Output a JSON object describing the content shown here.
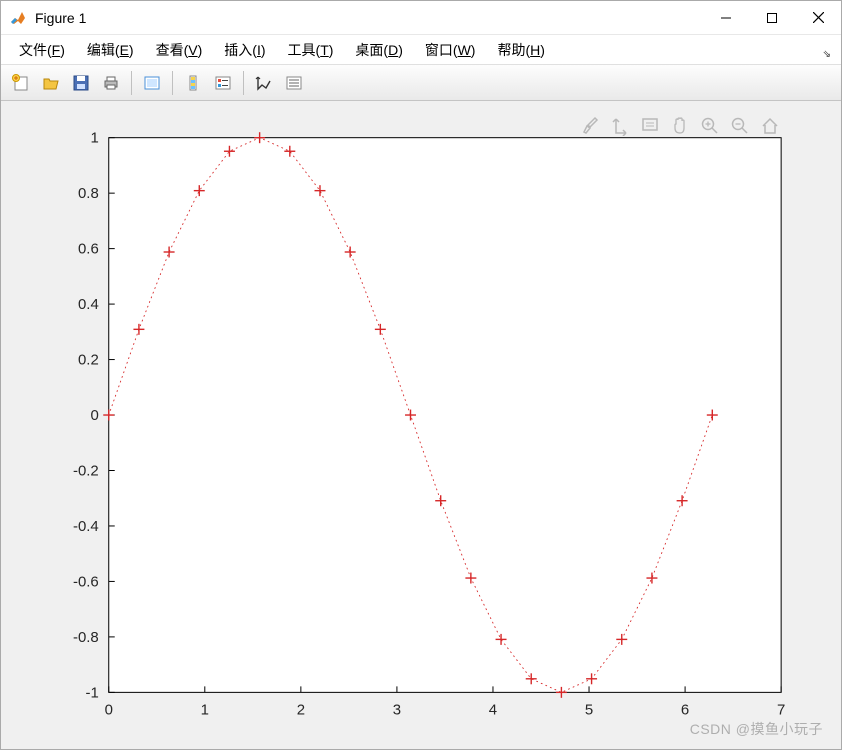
{
  "window": {
    "title": "Figure 1"
  },
  "menu": {
    "items": [
      {
        "label": "文件",
        "mnemonic": "F"
      },
      {
        "label": "编辑",
        "mnemonic": "E"
      },
      {
        "label": "查看",
        "mnemonic": "V"
      },
      {
        "label": "插入",
        "mnemonic": "I"
      },
      {
        "label": "工具",
        "mnemonic": "T"
      },
      {
        "label": "桌面",
        "mnemonic": "D"
      },
      {
        "label": "窗口",
        "mnemonic": "W"
      },
      {
        "label": "帮助",
        "mnemonic": "H"
      }
    ]
  },
  "toolbar_icons": [
    "new-figure",
    "open",
    "save",
    "print",
    "link",
    "linked-axes",
    "insert-colorbar",
    "insert-legend",
    "edit-plot",
    "data-cursor"
  ],
  "axes_toolbar_icons": [
    "brush",
    "rotate",
    "datatips",
    "pan",
    "zoom-in",
    "zoom-out",
    "home"
  ],
  "watermark": "CSDN @摸鱼小玩子",
  "colors": {
    "marker": "#d62728",
    "line": "#d62728",
    "axis": "#000000",
    "tick": "#262626",
    "background": "#f0f0f0"
  },
  "chart_data": {
    "type": "scatter",
    "title": "",
    "xlabel": "",
    "ylabel": "",
    "xlim": [
      0,
      7
    ],
    "ylim": [
      -1,
      1
    ],
    "xticks": [
      0,
      1,
      2,
      3,
      4,
      5,
      6,
      7
    ],
    "yticks": [
      -1,
      -0.8,
      -0.6,
      -0.4,
      -0.2,
      0,
      0.2,
      0.4,
      0.6,
      0.8,
      1
    ],
    "line_style": "dotted",
    "marker": "+",
    "x": [
      0,
      0.3142,
      0.6283,
      0.9425,
      1.2566,
      1.5708,
      1.885,
      2.1991,
      2.5133,
      2.8274,
      3.1416,
      3.4558,
      3.7699,
      4.0841,
      4.3982,
      4.7124,
      5.0265,
      5.3407,
      5.6549,
      5.969,
      6.2832
    ],
    "y": [
      0,
      0.309,
      0.5878,
      0.809,
      0.9511,
      1,
      0.9511,
      0.809,
      0.5878,
      0.309,
      0,
      -0.309,
      -0.5878,
      -0.809,
      -0.9511,
      -1,
      -0.9511,
      -0.809,
      -0.5878,
      -0.309,
      0
    ]
  }
}
